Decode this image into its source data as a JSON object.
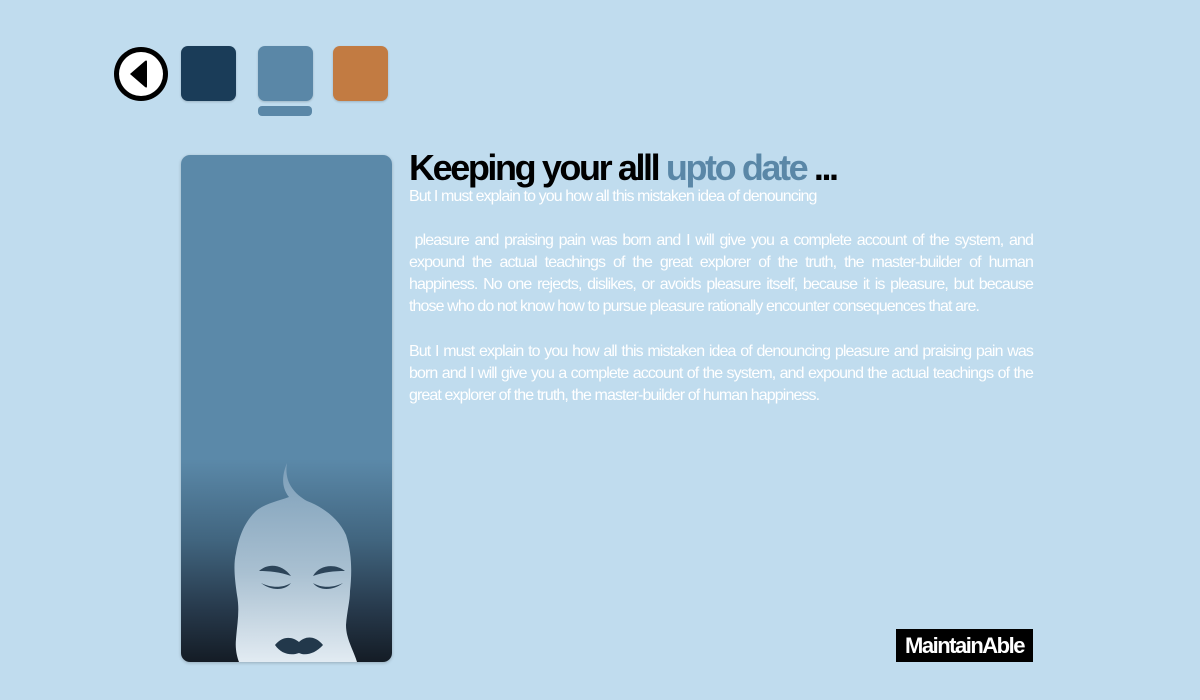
{
  "nav": {
    "back_icon": "back-arrow-icon"
  },
  "theme_swatches": [
    {
      "name": "dark-blue",
      "color": "#1a3c58"
    },
    {
      "name": "steel-blue",
      "color": "#5a87a7",
      "selected": true
    },
    {
      "name": "orange",
      "color": "#c27b42"
    }
  ],
  "colors": {
    "background": "#c0dcee",
    "accent": "#5a87a7",
    "text_light": "#ffffff"
  },
  "portrait": {
    "icon": "woman-face-icon"
  },
  "headline": {
    "part1": "Keeping your alll ",
    "accent": "upto date",
    "part2": " ..."
  },
  "body": {
    "intro": "But I must explain to you how all this mistaken idea of denouncing",
    "paragraph1": " pleasure and praising pain was born and I will give you a complete account of the system, and expound the actual teachings of the great explorer of the truth, the master-builder of human happiness. No one rejects, dislikes, or avoids pleasure itself, because it is pleasure, but because those who do not know how to pursue pleasure rationally encounter consequences that are.",
    "paragraph2": "But I must explain to you how all this mistaken idea of denouncing pleasure and praising pain was born and I will give you a complete account of the system, and expound the actual teachings of the great explorer of the truth, the master-builder of human happiness."
  },
  "logo": {
    "text": "MaintainAble"
  }
}
